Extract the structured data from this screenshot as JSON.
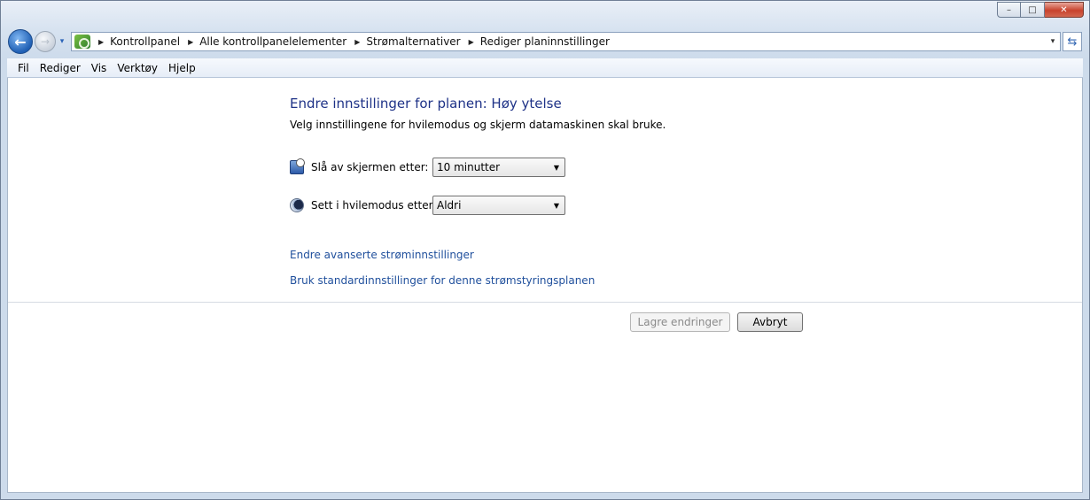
{
  "window": {
    "controls": {
      "minimize": "–",
      "maximize": "□",
      "close": "✕"
    }
  },
  "nav": {
    "back_glyph": "←",
    "forward_glyph": "→",
    "dropdown_glyph": "▾",
    "breadcrumb": [
      "Kontrollpanel",
      "Alle kontrollpanelelementer",
      "Strømalternativer",
      "Rediger planinnstillinger"
    ],
    "crumb_separator": "▶",
    "address_dropdown_glyph": "▾",
    "refresh_glyph": "⇆"
  },
  "menubar": {
    "items": [
      "Fil",
      "Rediger",
      "Vis",
      "Verktøy",
      "Hjelp"
    ]
  },
  "page": {
    "title": "Endre innstillinger for planen: Høy ytelse",
    "subtitle": "Velg innstillingene for hvilemodus og skjerm datamaskinen skal bruke.",
    "settings": [
      {
        "icon": "monitor-icon",
        "label": "Slå av skjermen etter:",
        "value": "10 minutter"
      },
      {
        "icon": "moon-icon",
        "label": "Sett i hvilemodus etter:",
        "value": "Aldri"
      }
    ],
    "links": {
      "advanced": "Endre avanserte strøminnstillinger",
      "restore_defaults": "Bruk standardinnstillinger for denne strømstyringsplanen"
    },
    "buttons": {
      "save": "Lagre endringer",
      "cancel": "Avbryt"
    },
    "select_arrow": "▼"
  }
}
